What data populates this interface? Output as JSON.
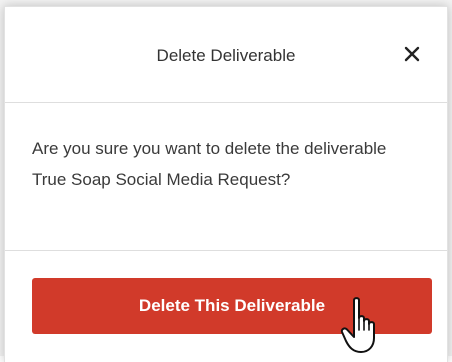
{
  "dialog": {
    "title": "Delete Deliverable",
    "close_icon": "close-icon",
    "message": "Are you sure you want to delete the deliverable True Soap Social Media Request?",
    "confirm_label": "Delete This Deliverable"
  },
  "colors": {
    "danger": "#d13a2a",
    "text": "#333333",
    "divider": "#dedede"
  },
  "cursor": {
    "icon": "hand-pointer-icon"
  }
}
